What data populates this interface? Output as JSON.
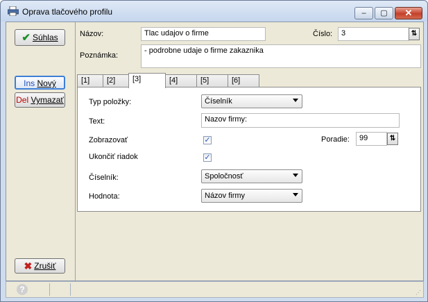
{
  "window": {
    "title": "Oprava tlačového profilu",
    "controls": {
      "minimize": "–",
      "maximize": "▢",
      "close": "✕"
    }
  },
  "buttons": {
    "ok": {
      "label": "Súhlas"
    },
    "new": {
      "key": "Ins",
      "label": "Nový"
    },
    "delete": {
      "key": "Del",
      "label": "Vymazať"
    },
    "cancel": {
      "label": "Zrušiť"
    }
  },
  "header": {
    "name_label": "Názov:",
    "name_value": "Tlac udajov o firme",
    "number_label": "Číslo:",
    "number_value": "3",
    "note_label": "Poznámka:",
    "note_value": "- podrobne udaje o firme zakaznika"
  },
  "tabs": [
    "[1]",
    "[2]",
    "[3]",
    "[4]",
    "[5]",
    "[6]"
  ],
  "active_tab": "[3]",
  "form": {
    "type_label": "Typ položky:",
    "type_value": "Číselník",
    "text_label": "Text:",
    "text_value": "Nazov firmy:",
    "show_label": "Zobrazovať",
    "show_checked": true,
    "order_label": "Poradie:",
    "order_value": "99",
    "endline_label": "Ukončiť riadok",
    "endline_checked": true,
    "codebook_label": "Číselník:",
    "codebook_value": "Spoločnosť",
    "value_label": "Hodnota:",
    "value_value": "Názov firmy"
  },
  "icons": {
    "app": "printer-icon",
    "ok": "check-icon",
    "cancel": "x-icon",
    "help": "help-icon",
    "spin": "spin-arrows-icon"
  },
  "colors": {
    "key_red": "#c00000",
    "key_blue": "#1f4fb8",
    "check_green": "#1f8f2a",
    "close_red": "#c4402a"
  }
}
